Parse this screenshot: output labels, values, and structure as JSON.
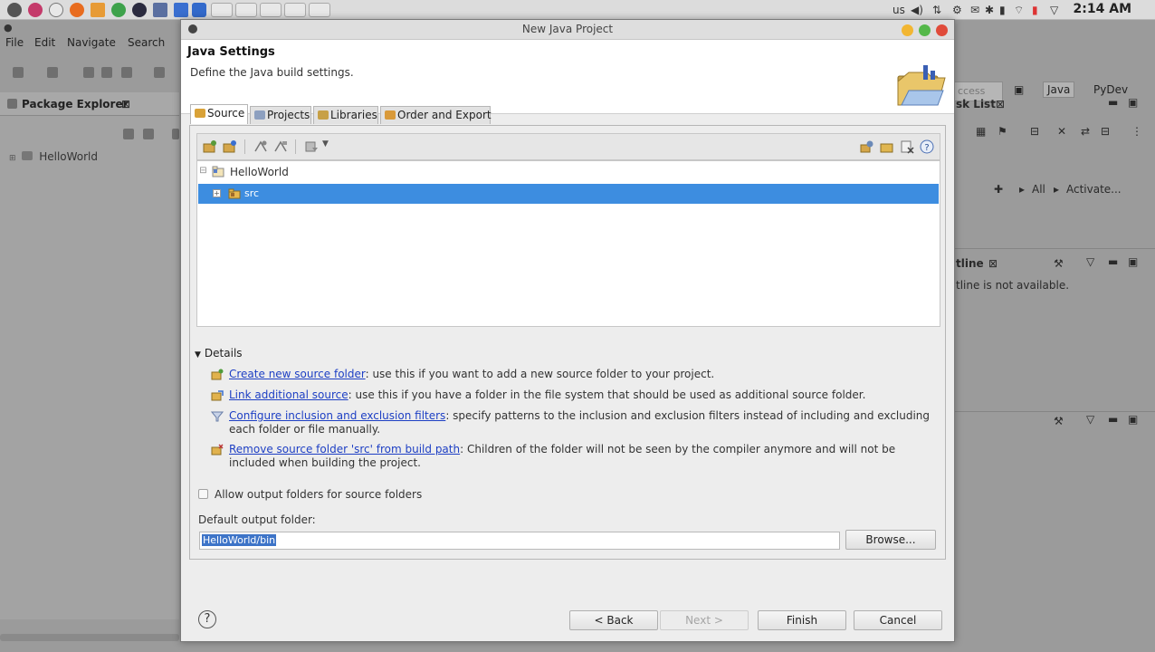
{
  "system_bar": {
    "keyboard_layout": "us",
    "clock": "2:14 AM"
  },
  "eclipse": {
    "menu": [
      "File",
      "Edit",
      "Navigate",
      "Search"
    ],
    "package_explorer_title": "Package Explorer",
    "package_explorer_tab_glyph": "⊠",
    "project_item": "HelloWorld",
    "perspectives": {
      "java": "Java",
      "pydev": "PyDev"
    },
    "quick_access_placeholder": "ccess",
    "task_list_title": "sk List",
    "tasks_filter": "All",
    "tasks_activate": "Activate...",
    "outline_title": "tline",
    "outline_message": "tline is not available."
  },
  "dialog": {
    "window_title": "New Java Project",
    "heading": "Java Settings",
    "subheading": "Define the Java build settings.",
    "tabs": [
      {
        "label": "Source",
        "active": true
      },
      {
        "label": "Projects",
        "active": false
      },
      {
        "label": "Libraries",
        "active": false
      },
      {
        "label": "Order and Export",
        "active": false
      }
    ],
    "tree": {
      "project": "HelloWorld",
      "selected_folder": "src"
    },
    "details": {
      "header": "Details",
      "items": [
        {
          "link": "Create new source folder",
          "text": ": use this if you want to add a new source folder to your project."
        },
        {
          "link": "Link additional source",
          "text": ": use this if you have a folder in the file system that should be used as additional source folder."
        },
        {
          "link": "Configure inclusion and exclusion filters",
          "text": ": specify patterns to the inclusion and exclusion filters instead of including and excluding each folder or file manually."
        },
        {
          "link": "Remove source folder 'src' from build path",
          "text": ": Children of the folder will not be seen by the compiler anymore and will not be included when building the project."
        }
      ]
    },
    "allow_output_folders_label": "Allow output folders for source folders",
    "allow_output_folders_checked": false,
    "default_output_label": "Default output folder:",
    "default_output_value": "HelloWorld/bin",
    "browse_label": "Browse...",
    "buttons": {
      "help": "?",
      "back": "< Back",
      "next": "Next >",
      "finish": "Finish",
      "cancel": "Cancel"
    }
  },
  "colors": {
    "selection": "#3d8de0",
    "link": "#1d3fc4",
    "close_button": "#e04b3a",
    "maximize_button": "#55b84a",
    "minimize_button": "#f2b632"
  }
}
